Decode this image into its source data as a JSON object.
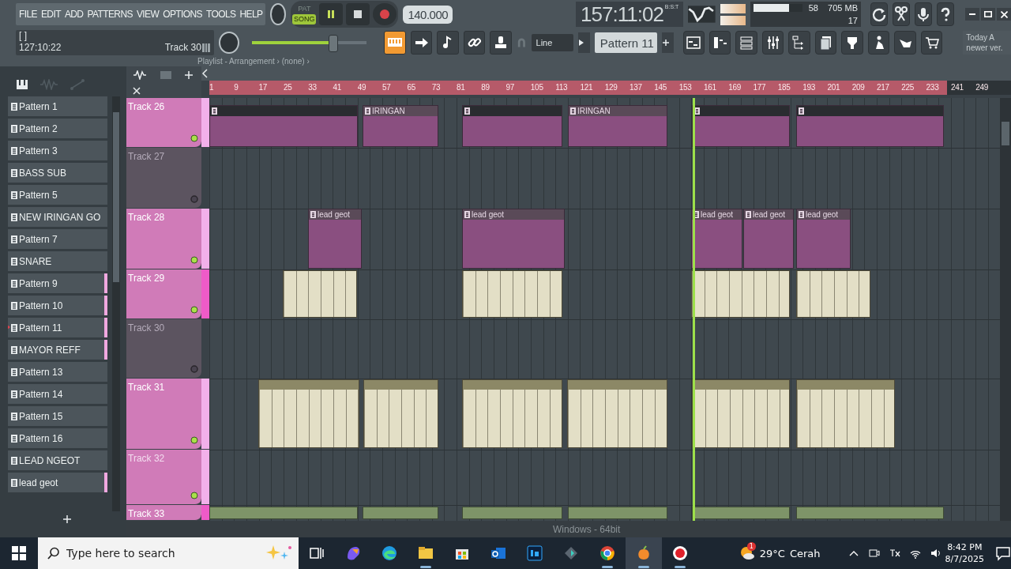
{
  "menu": [
    "FILE",
    "EDIT",
    "ADD",
    "PATTERNS",
    "VIEW",
    "OPTIONS",
    "TOOLS",
    "HELP"
  ],
  "transport": {
    "modes": [
      {
        "label": "PAT",
        "selected": false
      },
      {
        "label": "SONG",
        "selected": true
      }
    ],
    "playing": true,
    "recording": false,
    "tempo": "140.000",
    "time": "157:11:02",
    "time_unit": "B:S:T"
  },
  "cpu": {
    "level": 0.72,
    "value": "58",
    "memory": "705 MB",
    "polyphony": "17"
  },
  "hint": {
    "text": "[ ]",
    "time": "127:10:22",
    "track": "Track 30"
  },
  "master": {
    "level": 0.7
  },
  "tools": [
    {
      "selected": true
    },
    {
      "selected": false
    },
    {
      "selected": false
    },
    {
      "selected": false
    },
    {
      "selected": false
    }
  ],
  "snap": "Line",
  "pattern_selector": "Pattern 11",
  "news": {
    "line1": "Today A",
    "line2": "newer ver."
  },
  "breadcrumb": "Playlist - Arrangement › (none) ›",
  "patterns": [
    {
      "name": "Pattern 1",
      "selected": false,
      "marked": false
    },
    {
      "name": "Pattern 2",
      "selected": false,
      "marked": false
    },
    {
      "name": "Pattern 3",
      "selected": false,
      "marked": false
    },
    {
      "name": "BASS SUB",
      "selected": false,
      "marked": false
    },
    {
      "name": "Pattern 5",
      "selected": false,
      "marked": false
    },
    {
      "name": "NEW IRINGAN GO",
      "selected": false,
      "marked": false
    },
    {
      "name": "Pattern 7",
      "selected": false,
      "marked": false
    },
    {
      "name": "SNARE",
      "selected": false,
      "marked": false
    },
    {
      "name": "Pattern 9",
      "selected": false,
      "marked": true
    },
    {
      "name": "Pattern 10",
      "selected": false,
      "marked": true
    },
    {
      "name": "Pattern 11",
      "selected": true,
      "marked": true
    },
    {
      "name": "MAYOR REFF",
      "selected": false,
      "marked": true
    },
    {
      "name": "Pattern 13",
      "selected": false,
      "marked": false
    },
    {
      "name": "Pattern 14",
      "selected": false,
      "marked": false
    },
    {
      "name": "Pattern 15",
      "selected": false,
      "marked": false
    },
    {
      "name": "Pattern 16",
      "selected": false,
      "marked": false
    },
    {
      "name": "LEAD NGEOT",
      "selected": false,
      "marked": false
    },
    {
      "name": "lead geot",
      "selected": false,
      "marked": true
    }
  ],
  "ruler": [
    "1",
    "9",
    "17",
    "25",
    "33",
    "41",
    "49",
    "57",
    "65",
    "73",
    "81",
    "89",
    "97",
    "105",
    "113",
    "121",
    "129",
    "137",
    "145",
    "153",
    "161",
    "169",
    "177",
    "185",
    "193",
    "201",
    "209",
    "217",
    "225",
    "233",
    "241",
    "249"
  ],
  "playhead": {
    "level": 0.612
  },
  "tracks": [
    {
      "name": "Track 26",
      "muted": false,
      "faded": false,
      "clips": [
        {
          "kind": "pattern"
        },
        {
          "kind": "pattern",
          "label": "IRINGAN"
        },
        {
          "kind": "pattern"
        },
        {
          "kind": "pattern",
          "label": "IRINGAN"
        },
        {
          "kind": "pattern"
        },
        {
          "kind": "pattern"
        }
      ]
    },
    {
      "name": "Track 27",
      "muted": true,
      "faded": true
    },
    {
      "name": "Track 28",
      "muted": false,
      "faded": false,
      "clips": [
        {
          "kind": "pattern",
          "label": "lead geot"
        },
        {
          "kind": "pattern",
          "label": "lead geot"
        },
        {
          "kind": "pattern",
          "label": "lead geot"
        },
        {
          "kind": "pattern",
          "label": "lead geot"
        },
        {
          "kind": "pattern",
          "label": "lead geot"
        }
      ]
    },
    {
      "name": "Track 29",
      "muted": false,
      "faded": false,
      "clips": [
        {
          "kind": "audio"
        },
        {
          "kind": "audio"
        },
        {
          "kind": "audio"
        },
        {
          "kind": "audio"
        }
      ]
    },
    {
      "name": "Track 30",
      "muted": true,
      "faded": true
    },
    {
      "name": "Track 31",
      "muted": false,
      "faded": false,
      "clips": [
        {
          "kind": "audio"
        },
        {
          "kind": "audio"
        },
        {
          "kind": "audio"
        },
        {
          "kind": "audio"
        },
        {
          "kind": "audio"
        },
        {
          "kind": "audio"
        }
      ]
    },
    {
      "name": "Track 32",
      "muted": false,
      "faded": true
    },
    {
      "name": "Track 33",
      "muted": false,
      "faded": false,
      "clips": [
        {
          "kind": "automation"
        },
        {
          "kind": "automation"
        },
        {
          "kind": "automation"
        },
        {
          "kind": "automation"
        },
        {
          "kind": "automation"
        },
        {
          "kind": "automation"
        }
      ]
    }
  ],
  "status_hint": "Windows - 64bit",
  "taskbar": {
    "search_placeholder": "Type here to search",
    "apps": [
      {
        "running": false,
        "selected": false
      },
      {
        "running": false,
        "selected": false
      },
      {
        "running": false,
        "selected": false
      },
      {
        "running": true,
        "selected": false
      },
      {
        "running": false,
        "selected": false
      },
      {
        "running": false,
        "selected": false
      },
      {
        "running": false,
        "selected": false
      },
      {
        "running": false,
        "selected": false
      },
      {
        "running": true,
        "selected": false
      },
      {
        "running": true,
        "selected": true
      },
      {
        "running": true,
        "selected": false
      }
    ],
    "weather_badge": "1",
    "temperature": "29°C",
    "weather": "Cerah",
    "time": "8:42 PM",
    "date": "8/7/2025"
  }
}
